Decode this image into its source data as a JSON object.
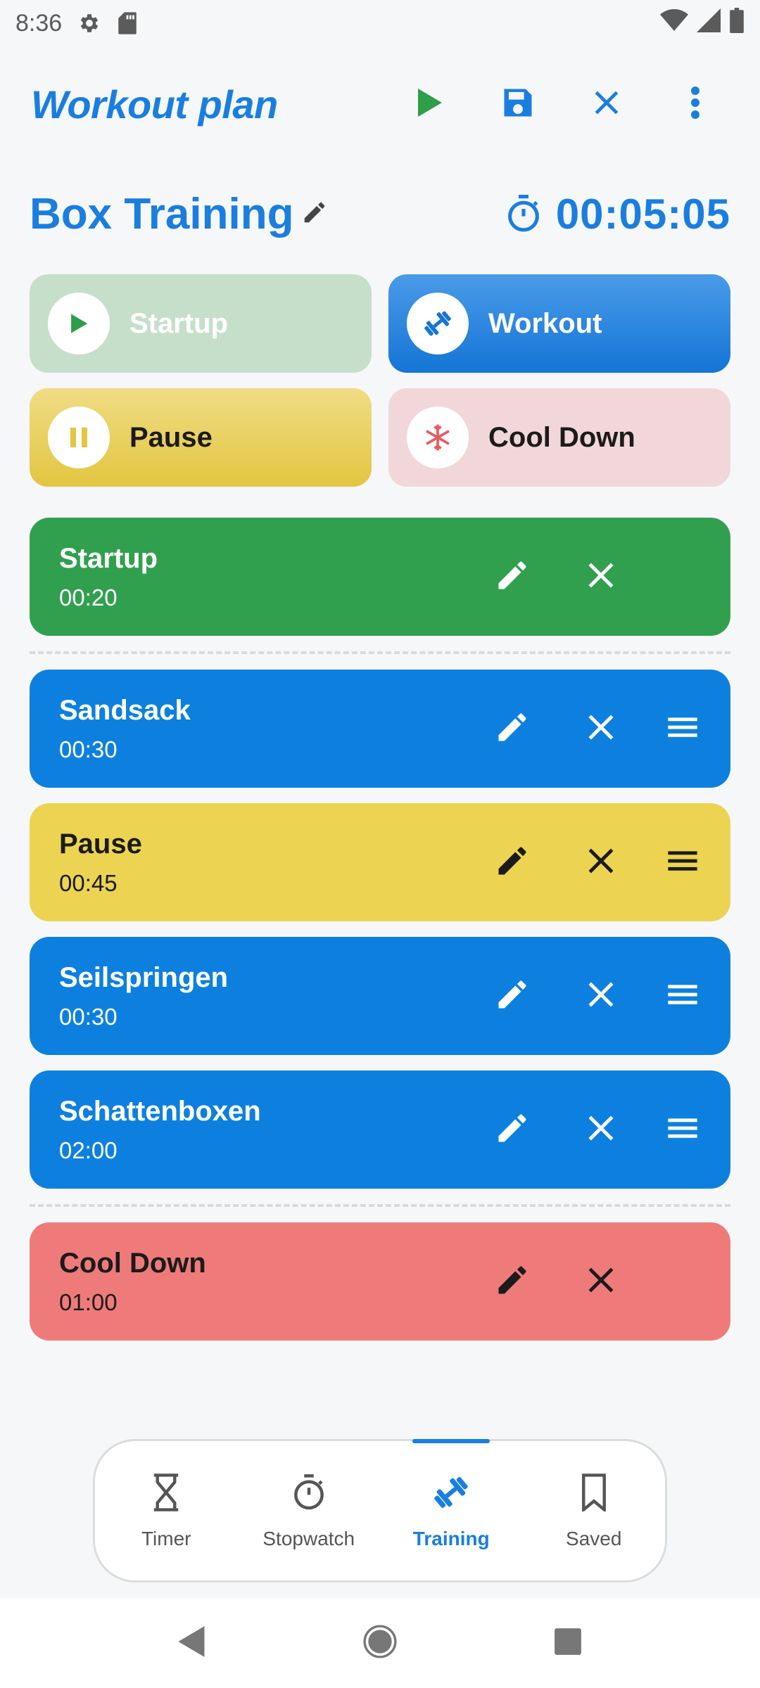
{
  "status_bar": {
    "time": "8:36",
    "icons": [
      "gear-icon",
      "sd-card-icon",
      "wifi-icon",
      "cell-signal-icon",
      "battery-icon"
    ]
  },
  "app_bar": {
    "title": "Workout plan",
    "actions": [
      "play-icon",
      "save-icon",
      "close-icon",
      "more-vert-icon"
    ],
    "colors": {
      "accent": "#1a7ee0",
      "play": "#2e9e48"
    }
  },
  "plan": {
    "name": "Box Training",
    "total_duration": "00:05:05"
  },
  "add_chips": [
    {
      "key": "startup",
      "label": "Startup",
      "icon": "play-icon"
    },
    {
      "key": "workout",
      "label": "Workout",
      "icon": "dumbbell-icon"
    },
    {
      "key": "pause",
      "label": "Pause",
      "icon": "pause-icon"
    },
    {
      "key": "cooldown",
      "label": "Cool Down",
      "icon": "snowflake-icon"
    }
  ],
  "exercises": [
    {
      "name": "Startup",
      "duration": "00:20",
      "type": "startup",
      "color": "#31a04e"
    },
    {
      "name": "Sandsack",
      "duration": "00:30",
      "type": "workout",
      "color": "#0d80df"
    },
    {
      "name": "Pause",
      "duration": "00:45",
      "type": "pause",
      "color": "#ecd452"
    },
    {
      "name": "Seilspringen",
      "duration": "00:30",
      "type": "workout",
      "color": "#0d80df"
    },
    {
      "name": "Schattenboxen",
      "duration": "02:00",
      "type": "workout",
      "color": "#0d80df"
    },
    {
      "name": "Cool Down",
      "duration": "01:00",
      "type": "cooldown",
      "color": "#ef7a7a"
    }
  ],
  "bottom_nav": {
    "items": [
      {
        "label": "Timer",
        "icon": "hourglass-icon"
      },
      {
        "label": "Stopwatch",
        "icon": "stopwatch-icon"
      },
      {
        "label": "Training",
        "icon": "dumbbell-icon",
        "active": true
      },
      {
        "label": "Saved",
        "icon": "bookmark-icon"
      }
    ]
  },
  "system_nav": [
    "back-icon",
    "home-icon",
    "recents-icon"
  ]
}
